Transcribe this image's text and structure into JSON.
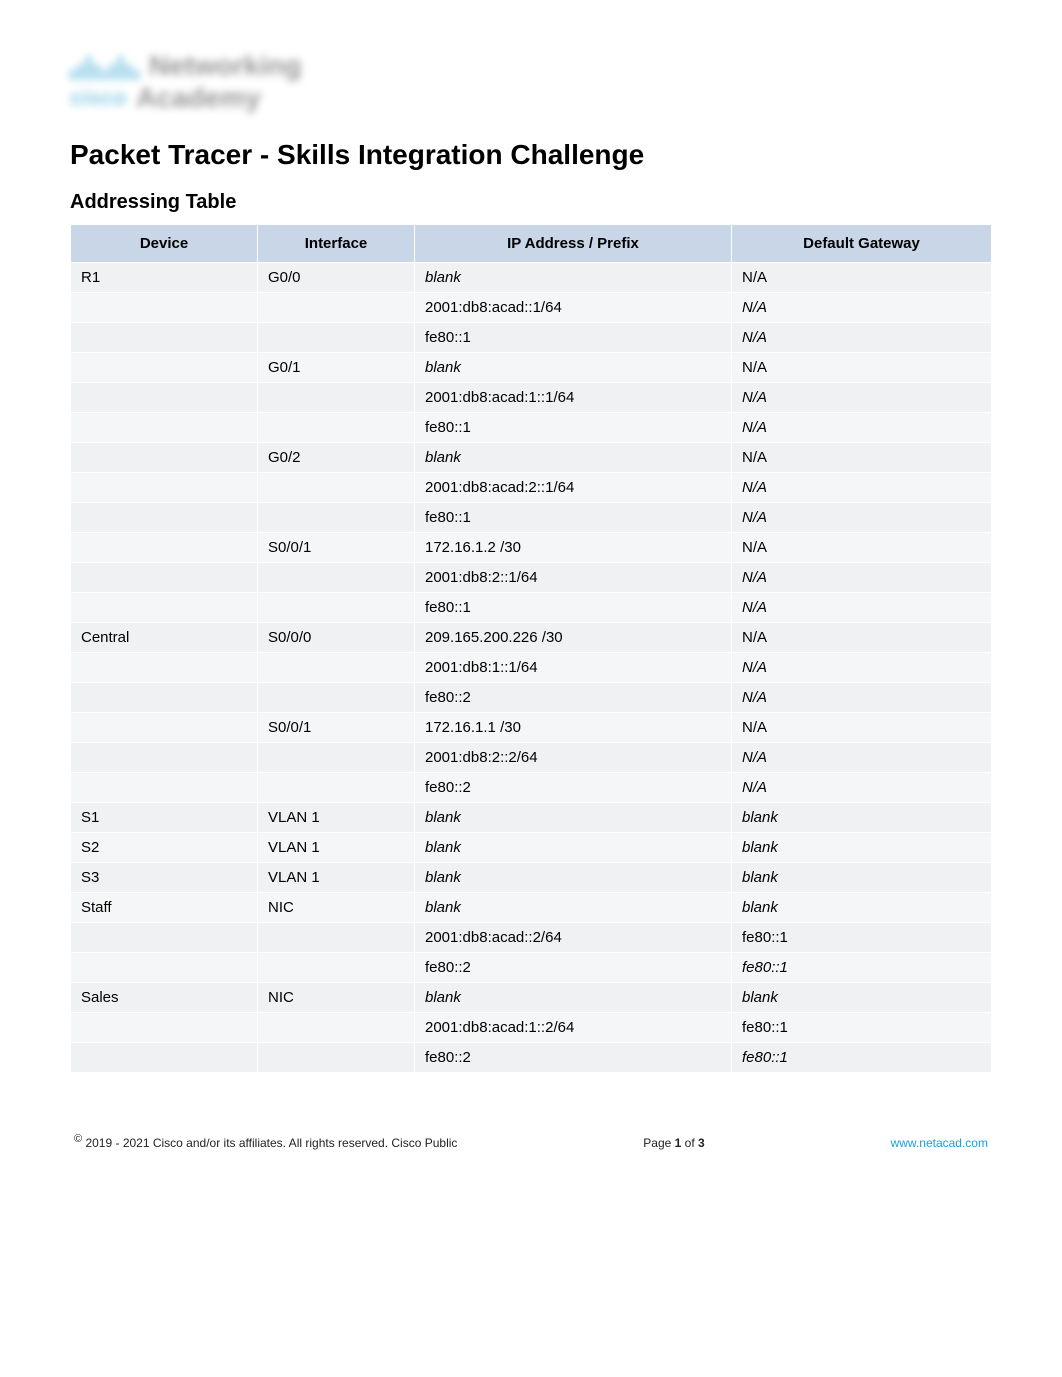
{
  "logo": {
    "brand": "cisco",
    "line1": "Networking",
    "line2": "Academy"
  },
  "page_title": "Packet Tracer - Skills Integration Challenge",
  "section_title": "Addressing Table",
  "table": {
    "headers": {
      "device": "Device",
      "interface": "Interface",
      "ip": "IP Address / Prefix",
      "gateway": "Default Gateway"
    },
    "rows": [
      {
        "device": "R1",
        "interface": "G0/0",
        "ip": "blank",
        "ip_style": "red-italic",
        "gw": "N/A",
        "gw_style": "red"
      },
      {
        "device": "",
        "interface": "",
        "ip": "2001:db8:acad::1/64",
        "ip_style": "red",
        "gw": "N/A",
        "gw_style": "red-italic"
      },
      {
        "device": "",
        "interface": "",
        "ip": "fe80::1",
        "ip_style": "red",
        "gw": "N/A",
        "gw_style": "red-italic"
      },
      {
        "device": "",
        "interface": "G0/1",
        "ip": "blank",
        "ip_style": "red-italic",
        "gw": "N/A",
        "gw_style": "red"
      },
      {
        "device": "",
        "interface": "",
        "ip": "2001:db8:acad:1::1/64",
        "ip_style": "red",
        "gw": "N/A",
        "gw_style": "red-italic"
      },
      {
        "device": "",
        "interface": "",
        "ip": "fe80::1",
        "ip_style": "red",
        "gw": "N/A",
        "gw_style": "red-italic"
      },
      {
        "device": "",
        "interface": "G0/2",
        "ip": "blank",
        "ip_style": "red-italic",
        "gw": "N/A",
        "gw_style": "red"
      },
      {
        "device": "",
        "interface": "",
        "ip": "2001:db8:acad:2::1/64",
        "ip_style": "red",
        "gw": "N/A",
        "gw_style": "red-italic"
      },
      {
        "device": "",
        "interface": "",
        "ip": "fe80::1",
        "ip_style": "red",
        "gw": "N/A",
        "gw_style": "red-italic"
      },
      {
        "device": "",
        "interface": "S0/0/1",
        "ip": "172.16.1.2 /30",
        "ip_style": "red",
        "gw": "N/A",
        "gw_style": "red"
      },
      {
        "device": "",
        "interface": "",
        "ip": "2001:db8:2::1/64",
        "ip_style": "red",
        "gw": "N/A",
        "gw_style": "red-italic"
      },
      {
        "device": "",
        "interface": "",
        "ip": "fe80::1",
        "ip_style": "red",
        "gw": "N/A",
        "gw_style": "red-italic"
      },
      {
        "device": "Central",
        "interface": "S0/0/0",
        "ip": "209.165.200.226 /30",
        "ip_style": "red",
        "gw": "N/A",
        "gw_style": "red"
      },
      {
        "device": "",
        "interface": "",
        "ip": "2001:db8:1::1/64",
        "ip_style": "red",
        "gw": "N/A",
        "gw_style": "red-italic"
      },
      {
        "device": "",
        "interface": "",
        "ip": "fe80::2",
        "ip_style": "red",
        "gw": "N/A",
        "gw_style": "red-italic"
      },
      {
        "device": "",
        "interface": "S0/0/1",
        "ip": "172.16.1.1 /30",
        "ip_style": "red",
        "gw": "N/A",
        "gw_style": "red"
      },
      {
        "device": "",
        "interface": "",
        "ip": "2001:db8:2::2/64",
        "ip_style": "red",
        "gw": "N/A",
        "gw_style": "red-italic"
      },
      {
        "device": "",
        "interface": "",
        "ip": "fe80::2",
        "ip_style": "red",
        "gw": "N/A",
        "gw_style": "red-italic"
      },
      {
        "device": "S1",
        "interface": "VLAN 1",
        "ip": "blank",
        "ip_style": "red-italic",
        "gw": "blank",
        "gw_style": "red-italic"
      },
      {
        "device": "S2",
        "interface": "VLAN 1",
        "ip": "blank",
        "ip_style": "red-italic",
        "gw": "blank",
        "gw_style": "red-italic"
      },
      {
        "device": "S3",
        "interface": "VLAN 1",
        "ip": "blank",
        "ip_style": "red-italic",
        "gw": "blank",
        "gw_style": "red-italic"
      },
      {
        "device": "Staff",
        "interface": "NIC",
        "ip": "blank",
        "ip_style": "red-italic",
        "gw": "blank",
        "gw_style": "red-italic"
      },
      {
        "device": "",
        "interface": "",
        "ip": "2001:db8:acad::2/64",
        "ip_style": "red",
        "gw": "fe80::1",
        "gw_style": "red"
      },
      {
        "device": "",
        "interface": "",
        "ip": "fe80::2",
        "ip_style": "red",
        "gw": "fe80::1",
        "gw_style": "red-italic"
      },
      {
        "device": "Sales",
        "interface": "NIC",
        "ip": "blank",
        "ip_style": "red-italic",
        "gw": "blank",
        "gw_style": "red-italic"
      },
      {
        "device": "",
        "interface": "",
        "ip": "2001:db8:acad:1::2/64",
        "ip_style": "red",
        "gw": "fe80::1",
        "gw_style": "red"
      },
      {
        "device": "",
        "interface": "",
        "ip": "fe80::2",
        "ip_style": "red",
        "gw": "fe80::1",
        "gw_style": "red-italic"
      }
    ]
  },
  "footer": {
    "copyright": "2019 - 2021 Cisco and/or its affiliates. All rights reserved. Cisco Public",
    "page_label_prefix": "Page ",
    "page_current": "1",
    "page_of": " of ",
    "page_total": "3",
    "link": "www.netacad.com"
  }
}
